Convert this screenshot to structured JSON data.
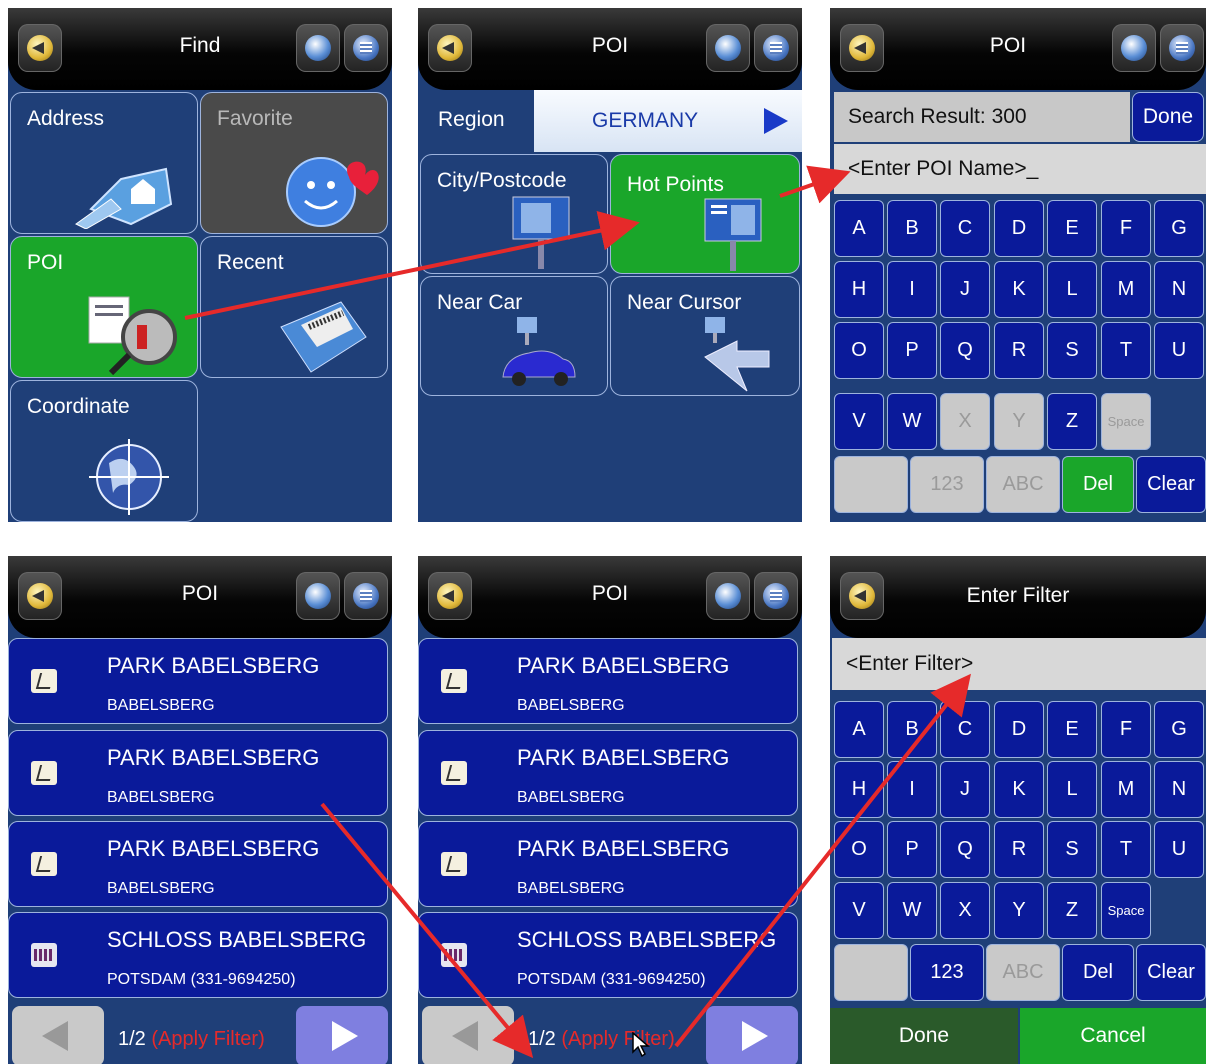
{
  "header_titles": {
    "find": "Find",
    "poi": "POI",
    "enter_filter": "Enter Filter"
  },
  "find": {
    "address": "Address",
    "favorite": "Favorite",
    "poi": "POI",
    "recent": "Recent",
    "coordinate": "Coordinate"
  },
  "poi_menu": {
    "region_label": "Region",
    "region_value": "GERMANY",
    "city_postcode": "City/Postcode",
    "hot_points": "Hot Points",
    "near_car": "Near Car",
    "near_cursor": "Near Cursor"
  },
  "search": {
    "result": "Search Result: 300",
    "done": "Done",
    "input": "<Enter POI Name>_"
  },
  "keyboard": {
    "row1": [
      "A",
      "B",
      "C",
      "D",
      "E",
      "F",
      "G"
    ],
    "row2": [
      "H",
      "I",
      "J",
      "K",
      "L",
      "M",
      "N"
    ],
    "row3": [
      "O",
      "P",
      "Q",
      "R",
      "S",
      "T",
      "U"
    ],
    "row4": [
      "V",
      "W",
      "X",
      "Y",
      "Z",
      "Space"
    ],
    "num": "123",
    "abc": "ABC",
    "del": "Del",
    "clear": "Clear"
  },
  "results": [
    {
      "title": "PARK BABELSBERG",
      "sub": "BABELSBERG",
      "icon": "poi-flag-icon"
    },
    {
      "title": "PARK BABELSBERG",
      "sub": "BABELSBERG",
      "icon": "poi-flag-icon"
    },
    {
      "title": "PARK BABELSBERG",
      "sub": "BABELSBERG",
      "icon": "poi-flag-icon"
    },
    {
      "title": "SCHLOSS BABELSBERG",
      "sub": "POTSDAM (331-9694250)",
      "icon": "museum-icon"
    }
  ],
  "pager": {
    "page": "1/2",
    "filter": "(Apply Filter)"
  },
  "filter": {
    "input": "<Enter Filter>",
    "done": "Done",
    "cancel": "Cancel"
  },
  "colors": {
    "panel": "#1f3f78",
    "key": "#0a1a9a",
    "green": "#1aa62a",
    "arrow": "#e62a2a"
  }
}
